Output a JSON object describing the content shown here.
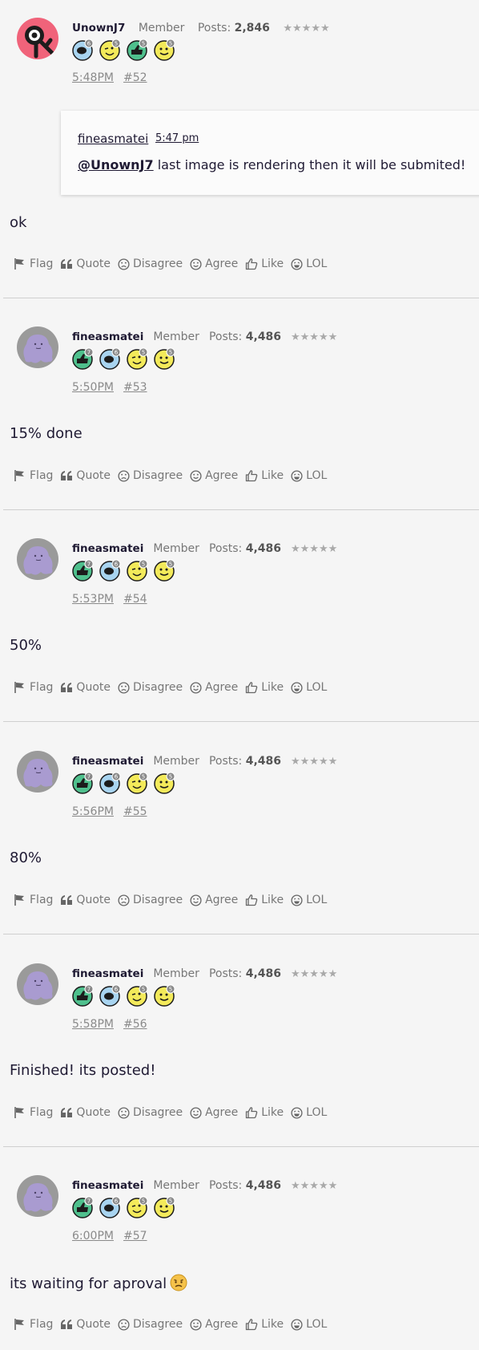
{
  "posts": [
    {
      "username": "UnownJ7",
      "role": "Member",
      "posts_label": "Posts:",
      "posts_count": "2,846",
      "stars": "★★★★★",
      "time": "5:48PM",
      "number": "#52",
      "quote": {
        "author": "fineasmatei",
        "time": "5:47 pm",
        "mention": "@UnownJ7",
        "text": " last image is rendering then it will be submited!"
      },
      "content": "ok",
      "badges": [
        {
          "icon": "speech-bubble-icon",
          "count": "6"
        },
        {
          "icon": "wink-emoji-icon",
          "count": "5"
        },
        {
          "icon": "thumbs-up-icon",
          "count": "5"
        },
        {
          "icon": "smile-emoji-icon",
          "count": "5"
        }
      ]
    },
    {
      "username": "fineasmatei",
      "role": "Member",
      "posts_label": "Posts:",
      "posts_count": "4,486",
      "stars": "★★★★★",
      "time": "5:50PM",
      "number": "#53",
      "content": "15% done",
      "badges": [
        {
          "icon": "thumbs-up-icon",
          "count": "7"
        },
        {
          "icon": "speech-bubble-icon",
          "count": "6"
        },
        {
          "icon": "wink-emoji-icon",
          "count": "5"
        },
        {
          "icon": "smile-emoji-icon",
          "count": "5"
        }
      ]
    },
    {
      "username": "fineasmatei",
      "role": "Member",
      "posts_label": "Posts:",
      "posts_count": "4,486",
      "stars": "★★★★★",
      "time": "5:53PM",
      "number": "#54",
      "content": "50%",
      "badges": [
        {
          "icon": "thumbs-up-icon",
          "count": "7"
        },
        {
          "icon": "speech-bubble-icon",
          "count": "6"
        },
        {
          "icon": "wink-emoji-icon",
          "count": "5"
        },
        {
          "icon": "smile-emoji-icon",
          "count": "5"
        }
      ]
    },
    {
      "username": "fineasmatei",
      "role": "Member",
      "posts_label": "Posts:",
      "posts_count": "4,486",
      "stars": "★★★★★",
      "time": "5:56PM",
      "number": "#55",
      "content": "80%",
      "badges": [
        {
          "icon": "thumbs-up-icon",
          "count": "7"
        },
        {
          "icon": "speech-bubble-icon",
          "count": "6"
        },
        {
          "icon": "wink-emoji-icon",
          "count": "5"
        },
        {
          "icon": "smile-emoji-icon",
          "count": "5"
        }
      ]
    },
    {
      "username": "fineasmatei",
      "role": "Member",
      "posts_label": "Posts:",
      "posts_count": "4,486",
      "stars": "★★★★★",
      "time": "5:58PM",
      "number": "#56",
      "content": "Finished! its posted!",
      "badges": [
        {
          "icon": "thumbs-up-icon",
          "count": "7"
        },
        {
          "icon": "speech-bubble-icon",
          "count": "6"
        },
        {
          "icon": "wink-emoji-icon",
          "count": "5"
        },
        {
          "icon": "smile-emoji-icon",
          "count": "5"
        }
      ]
    },
    {
      "username": "fineasmatei",
      "role": "Member",
      "posts_label": "Posts:",
      "posts_count": "4,486",
      "stars": "★★★★★",
      "time": "6:00PM",
      "number": "#57",
      "content": "its waiting for aproval",
      "content_emoji": "sad-face-emoji",
      "badges": [
        {
          "icon": "thumbs-up-icon",
          "count": "7"
        },
        {
          "icon": "speech-bubble-icon",
          "count": "6"
        },
        {
          "icon": "wink-emoji-icon",
          "count": "5"
        },
        {
          "icon": "smile-emoji-icon",
          "count": "5"
        }
      ]
    }
  ],
  "actions": {
    "flag": "Flag",
    "quote": "Quote",
    "disagree": "Disagree",
    "agree": "Agree",
    "like": "Like",
    "lol": "LOL"
  },
  "colors": {
    "username": "#1f1a33",
    "meta_gray": "#777777",
    "divider": "#cfcfcf",
    "badge_blue": "#a8d4f0",
    "badge_yellow": "#f3ea5a",
    "badge_green": "#4fc08d",
    "avatar_purple": "#a99bd0"
  }
}
